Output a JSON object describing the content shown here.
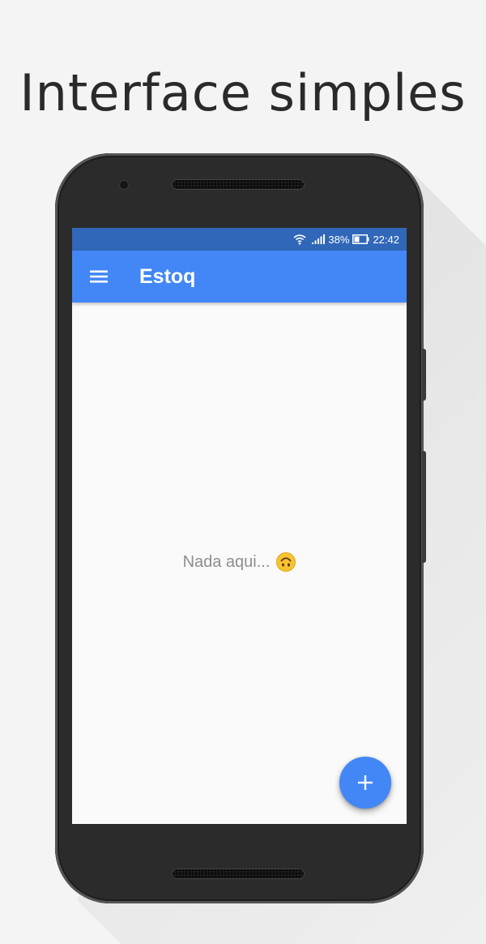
{
  "promo": {
    "title": "Interface simples"
  },
  "status_bar": {
    "battery_percent": "38%",
    "time": "22:42",
    "icons": [
      "wifi-icon",
      "signal-icon",
      "battery-icon"
    ]
  },
  "app_bar": {
    "title": "Estoq",
    "menu_icon": "menu-icon"
  },
  "main": {
    "empty_message": "Nada aqui...",
    "empty_emoji": "upside-down-face-icon"
  },
  "fab": {
    "icon": "plus-icon",
    "color": "#4287f5"
  },
  "colors": {
    "primary": "#4287f5",
    "status_bar": "#3167b9",
    "background": "#fafafa"
  }
}
